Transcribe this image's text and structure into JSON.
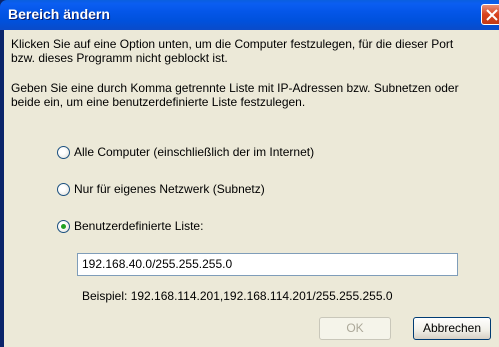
{
  "window": {
    "title": "Bereich ändern"
  },
  "paragraph1": {
    "line1": "Klicken Sie auf eine Option unten, um die Computer festzulegen, für die dieser Port",
    "line2": "bzw. dieses Programm nicht geblockt ist."
  },
  "paragraph2": {
    "line1": "Geben Sie eine durch Komma getrennte Liste mit IP-Adressen bzw. Subnetzen oder",
    "line2": "beide ein, um eine benutzerdefinierte Liste festzulegen."
  },
  "options": [
    {
      "label": "Alle Computer (einschließlich der im Internet)",
      "selected": false
    },
    {
      "label": "Nur für eigenes Netzwerk (Subnetz)",
      "selected": false
    },
    {
      "label": "Benutzerdefinierte Liste:",
      "selected": true
    }
  ],
  "custom_list": {
    "value": "192.168.40.0/255.255.255.0"
  },
  "example": "Beispiel: 192.168.114.201,192.168.114.201/255.255.255.0",
  "buttons": {
    "ok": "OK",
    "cancel": "Abbrechen"
  },
  "colors": {
    "titlebar": "#0054e3",
    "dialog_bg": "#ece9d8",
    "close_button": "#d9421d",
    "radio_dot": "#21a121"
  }
}
